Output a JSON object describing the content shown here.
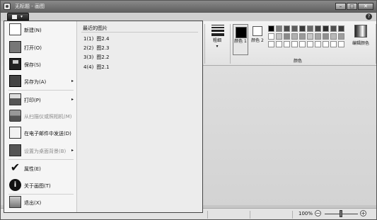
{
  "window": {
    "title": "无标题 - 画图",
    "controls": {
      "minimize": "–",
      "maximize": "□",
      "close": "✕"
    }
  },
  "help_label": "?",
  "app_menu_button": {
    "caret": "▾"
  },
  "app_menu": {
    "items": [
      {
        "label": "新建(N)",
        "icon": "new-document-icon",
        "submenu": false,
        "enabled": true
      },
      {
        "label": "打开(O)",
        "icon": "open-folder-icon",
        "submenu": false,
        "enabled": true
      },
      {
        "label": "保存(S)",
        "icon": "save-disk-icon",
        "submenu": false,
        "enabled": true
      },
      {
        "label": "另存为(A)",
        "icon": "save-as-icon",
        "submenu": true,
        "enabled": true
      },
      {
        "label": "打印(P)",
        "icon": "printer-icon",
        "submenu": true,
        "enabled": true
      },
      {
        "label": "从扫描仪或照相机(M)",
        "icon": "scanner-icon",
        "submenu": false,
        "enabled": false
      },
      {
        "label": "在电子邮件中发送(D)",
        "icon": "email-icon",
        "submenu": false,
        "enabled": true
      },
      {
        "label": "设置为桌面背景(B)",
        "icon": "desktop-background-icon",
        "submenu": true,
        "enabled": false
      },
      {
        "label": "属性(E)",
        "icon": "checkmark-icon",
        "submenu": false,
        "enabled": true
      },
      {
        "label": "关于画图(T)",
        "icon": "info-icon",
        "submenu": false,
        "enabled": true
      },
      {
        "label": "退出(X)",
        "icon": "exit-icon",
        "submenu": false,
        "enabled": true
      }
    ],
    "submenu_arrow": "▸",
    "recent": {
      "title": "最近的图片",
      "items": [
        {
          "index": "1(1)",
          "name": "图2.4"
        },
        {
          "index": "2(2)",
          "name": "图2.3"
        },
        {
          "index": "3(3)",
          "name": "图2.2"
        },
        {
          "index": "4(4)",
          "name": "图2.1"
        }
      ]
    }
  },
  "ribbon": {
    "sizes_label": "粗细",
    "sizes_caret": "▾",
    "color1_label": "颜色 1",
    "color2_label": "颜色 2",
    "edit_colors_label": "编辑颜色",
    "colors_group_label": "颜色",
    "palette": [
      "#000000",
      "#7f7f7f",
      "#4a4a4a",
      "#5c5c5c",
      "#3a3a3a",
      "#6a6a6a",
      "#454545",
      "#2f2f2f",
      "#505050",
      "#3d3d3d",
      "#ffffff",
      "#c3c3c3",
      "#8a8a8a",
      "#b0b0b0",
      "#9a9a9a",
      "#c8c8c8",
      "#a6a6a6",
      "#8f8f8f",
      "#b8b8b8",
      "#9e9e9e",
      "#ffffff",
      "#ffffff",
      "#ffffff",
      "#ffffff",
      "#ffffff",
      "#ffffff",
      "#ffffff",
      "#ffffff",
      "#ffffff",
      "#ffffff"
    ]
  },
  "status": {
    "zoom": "100%",
    "zoom_out": "−",
    "zoom_in": "+"
  }
}
